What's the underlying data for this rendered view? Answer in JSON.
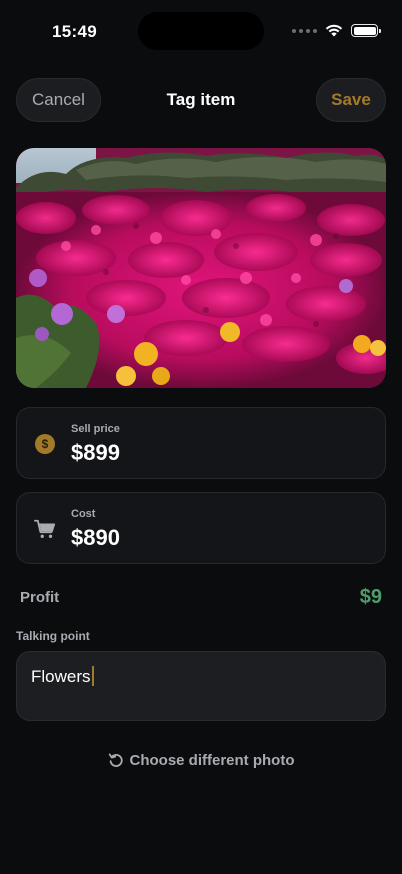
{
  "status_bar": {
    "time": "15:49"
  },
  "nav": {
    "cancel_label": "Cancel",
    "title": "Tag item",
    "save_label": "Save"
  },
  "photo": {
    "subject": "magenta ice plant flowers with yellow blooms"
  },
  "sell": {
    "label": "Sell price",
    "currency": "$",
    "amount": "899",
    "icon": "dollar-coin-icon",
    "icon_glyph": "$"
  },
  "cost": {
    "label": "Cost",
    "currency": "$",
    "amount": "890",
    "icon": "cart-icon"
  },
  "profit": {
    "label": "Profit",
    "value": "$9"
  },
  "talking_point": {
    "label": "Talking point",
    "value": "Flowers"
  },
  "choose_photo": {
    "label": "Choose different photo",
    "icon": "rotate-icon"
  },
  "colors": {
    "accent": "#a37a2a",
    "profit": "#4f9d6e",
    "background": "#0b0c0e",
    "card": "#141518"
  }
}
